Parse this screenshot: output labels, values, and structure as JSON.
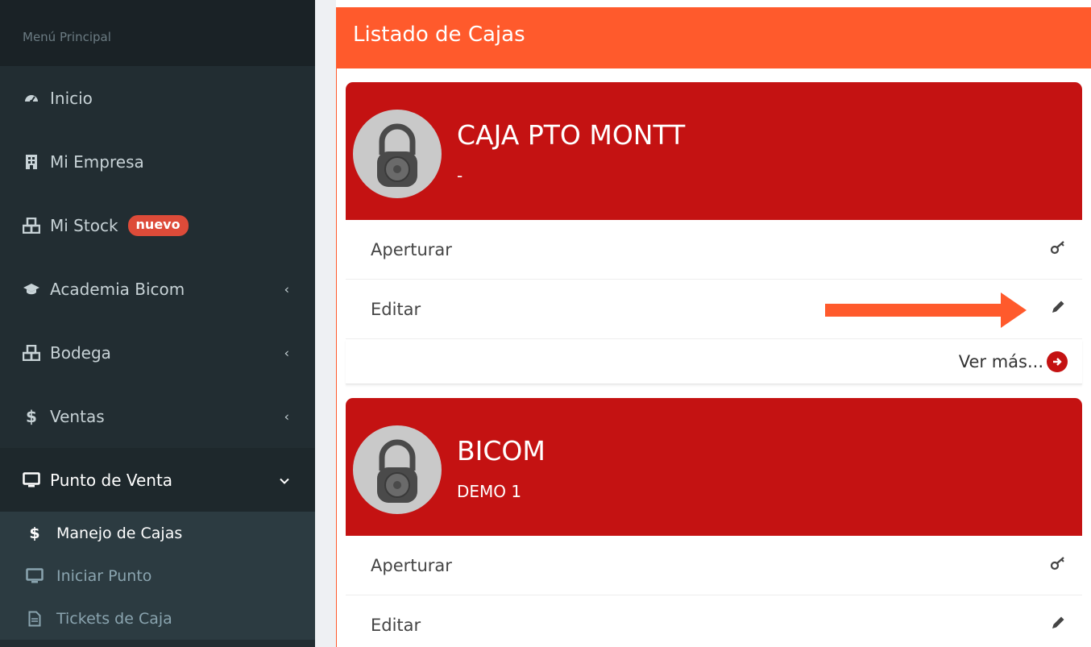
{
  "sidebar": {
    "header": "Menú Principal",
    "items": [
      {
        "label": "Inicio",
        "icon": "dashboard-icon"
      },
      {
        "label": "Mi Empresa",
        "icon": "building-icon"
      },
      {
        "label": "Mi Stock",
        "icon": "cubes-icon",
        "badge": "nuevo"
      },
      {
        "label": "Academia Bicom",
        "icon": "graduation-cap-icon"
      },
      {
        "label": "Bodega",
        "icon": "cubes-icon"
      },
      {
        "label": "Ventas",
        "icon": "dollar-icon"
      },
      {
        "label": "Punto de Venta",
        "icon": "desktop-icon"
      }
    ],
    "submenu": [
      {
        "label": "Manejo de Cajas",
        "icon": "dollar-icon"
      },
      {
        "label": "Iniciar Punto",
        "icon": "desktop-icon"
      },
      {
        "label": "Tickets de Caja",
        "icon": "file-text-icon"
      }
    ]
  },
  "panel": {
    "title": "Listado de Cajas"
  },
  "cards": [
    {
      "title": "CAJA PTO MONTT",
      "subtitle": "-",
      "open_label": "Aperturar",
      "edit_label": "Editar",
      "more_label": "Ver más..."
    },
    {
      "title": "BICOM",
      "subtitle": "DEMO 1",
      "open_label": "Aperturar",
      "edit_label": "Editar"
    }
  ],
  "colors": {
    "accent": "#ff5a2c",
    "card_red": "#c41212",
    "sidebar_bg": "#222d32",
    "badge_red": "#dd4b39"
  }
}
